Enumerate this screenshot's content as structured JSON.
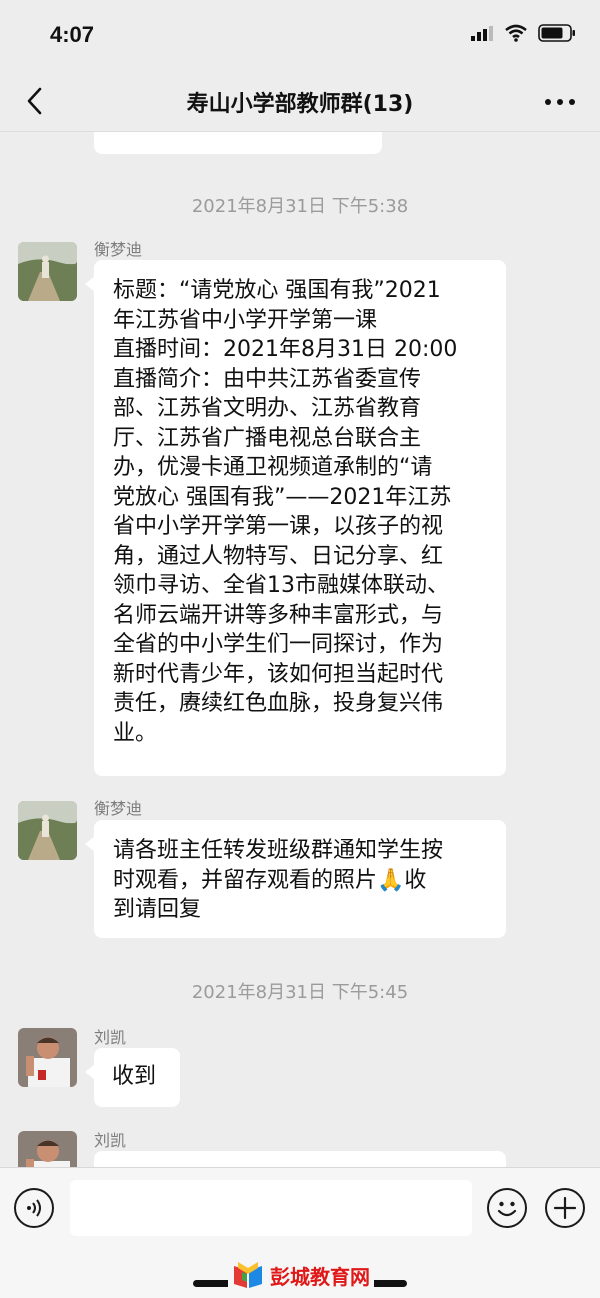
{
  "status_bar": {
    "time": "4:07"
  },
  "nav": {
    "title": "寿山小学部教师群(13)"
  },
  "messages": {
    "partial_top_text": "…………",
    "timestamp_1": "2021年8月31日 下午5:38",
    "msg1": {
      "sender": "衡梦迪",
      "lines": [
        "标题：“请党放心 强国有我”2021",
        "年江苏省中小学开学第一课",
        "直播时间：2021年8月31日 20:00",
        "直播简介：由中共江苏省委宣传",
        "部、江苏省文明办、江苏省教育",
        "厅、江苏省广播电视总台联合主",
        "办，优漫卡通卫视频道承制的“请",
        "党放心 强国有我”——2021年江苏",
        "省中小学开学第一课，以孩子的视",
        "角，通过人物特写、日记分享、红",
        "领巾寻访、全省13市融媒体联动、",
        "名师云端开讲等多种丰富形式，与",
        "全省的中小学生们一同探讨，作为",
        "新时代青少年，该如何担当起时代",
        "责任，赓续红色血脉，投身复兴伟",
        "业。"
      ]
    },
    "msg2": {
      "sender": "衡梦迪",
      "lines": [
        "请各班主任转发班级群通知学生按",
        "时观看，并留存观看的照片",
        "收",
        "到请回复"
      ]
    },
    "timestamp_2": "2021年8月31日 下午5:45",
    "msg3": {
      "sender": "刘凯",
      "text": "收到"
    },
    "msg4": {
      "sender": "刘凯"
    }
  },
  "input": {
    "placeholder": ""
  },
  "watermark": {
    "text": "彭城教育网"
  },
  "icons": {
    "back": "chevron-left-icon",
    "more": "more-dots-icon",
    "voice": "voice-icon",
    "emoji": "emoji-icon",
    "plus": "plus-icon",
    "signal": "signal-icon",
    "wifi": "wifi-icon",
    "battery": "battery-icon",
    "emoji_inline": "praying-hands-emoji"
  },
  "colors": {
    "background": "#ededed",
    "bubble": "#ffffff",
    "watermark_red": "#e01818"
  }
}
